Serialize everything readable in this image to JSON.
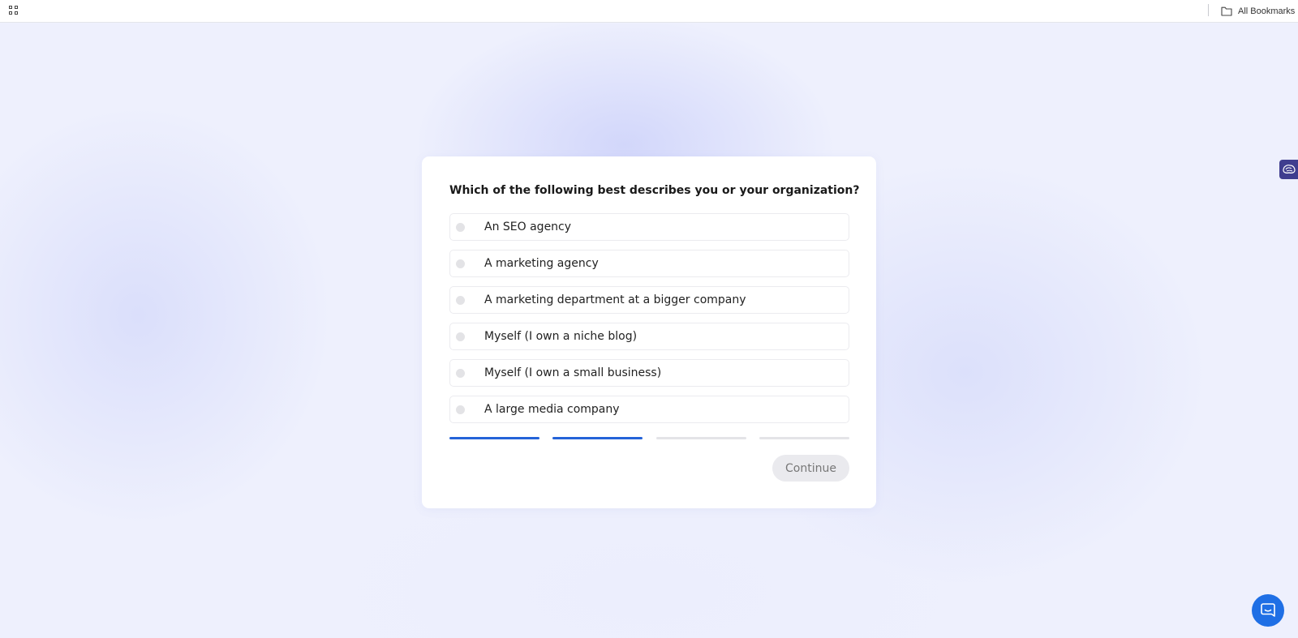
{
  "bookmarks_bar": {
    "apps_icon": "apps-grid-icon",
    "folder_icon": "folder-icon",
    "all_bookmarks_label": "All Bookmarks"
  },
  "survey": {
    "question": "Which of the following best describes you or your organization?",
    "options": [
      {
        "label": "An SEO agency",
        "selected": false
      },
      {
        "label": "A marketing agency",
        "selected": false
      },
      {
        "label": "A marketing department at a bigger company",
        "selected": false
      },
      {
        "label": "Myself (I own a niche blog)",
        "selected": false
      },
      {
        "label": "Myself (I own a small business)",
        "selected": false
      },
      {
        "label": "A large media company",
        "selected": false
      }
    ],
    "progress": {
      "completed_steps": 2,
      "total_steps": 4
    },
    "continue_label": "Continue",
    "continue_enabled": false
  },
  "widgets": {
    "side_widget_icon": "brain-icon",
    "chat_icon": "chat-bubble-icon"
  },
  "colors": {
    "accent": "#2463d8",
    "chat_button": "#1f6fe5",
    "side_widget": "#3f3d8f",
    "background": "#eef0fd"
  }
}
